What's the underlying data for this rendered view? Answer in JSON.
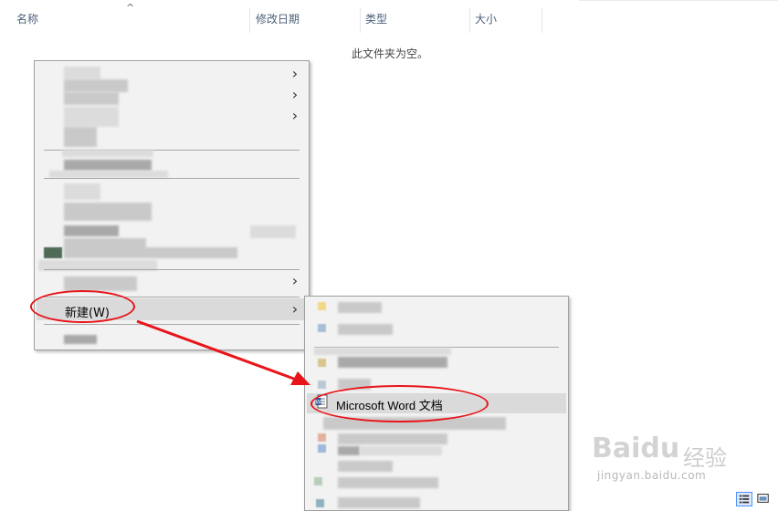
{
  "columns": [
    {
      "label": "名称"
    },
    {
      "label": "修改日期"
    },
    {
      "label": "类型"
    },
    {
      "label": "大小"
    }
  ],
  "sort_indicator": "^",
  "empty_folder_text": "此文件夹为空。",
  "context_menu": {
    "new_item_label": "新建(W)",
    "submenu_chevron": "›"
  },
  "new_submenu": {
    "word_doc_label": "Microsoft Word 文档"
  },
  "annotation": {
    "color": "#e8141a"
  },
  "watermark": {
    "logo_text": "Baidu",
    "cn_text": "经验",
    "url_text": "jingyan.baidu.com"
  },
  "icons": {
    "sort": "sort-arrow-icon",
    "chevron": "chevron-right-icon",
    "word": "word-document-icon",
    "details_view": "details-view-icon",
    "large_icons_view": "large-icons-view-icon"
  }
}
